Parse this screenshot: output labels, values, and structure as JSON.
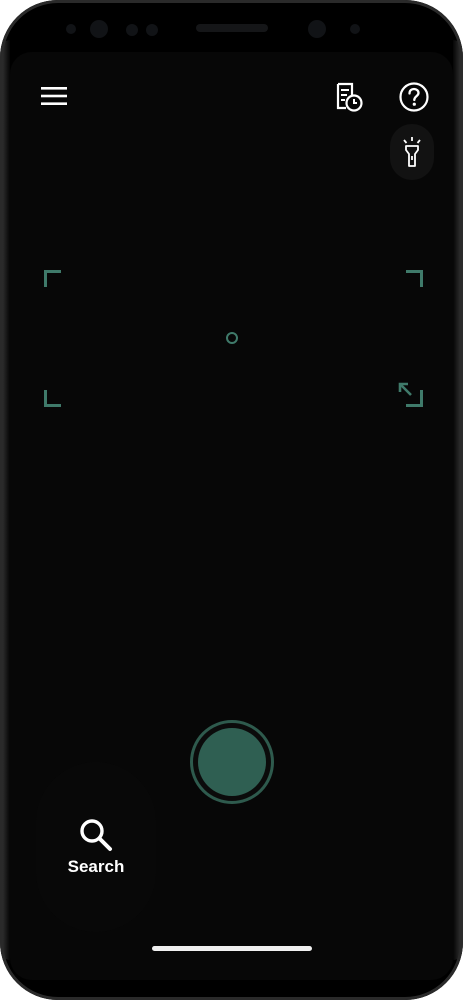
{
  "toolbar": {
    "menu_icon": "hamburger-menu-icon",
    "history_icon": "history-document-clock-icon",
    "help_icon": "help-question-icon",
    "flash_icon": "flashlight-icon"
  },
  "viewfinder": {
    "accent_color": "#3f7a6a",
    "expand_icon": "expand-arrow-icon"
  },
  "capture": {
    "shutter_color": "#2f5f52"
  },
  "search": {
    "label": "Search",
    "icon": "search-icon"
  }
}
